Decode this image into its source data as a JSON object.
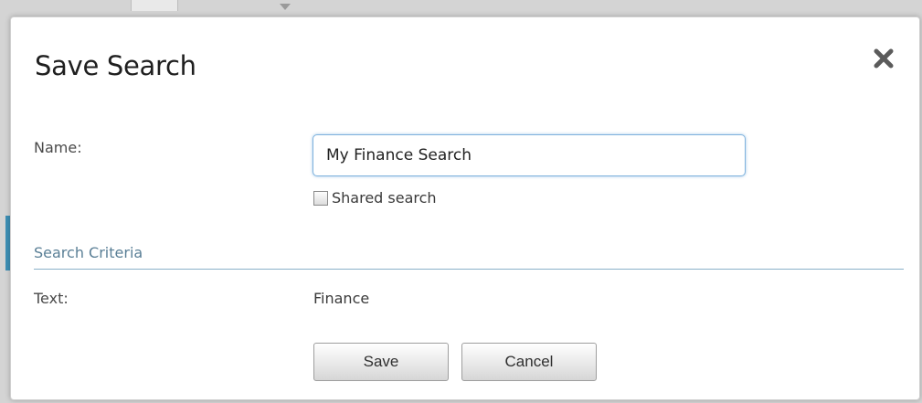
{
  "dialog": {
    "title": "Save Search",
    "close_icon": "close-icon"
  },
  "form": {
    "name_label": "Name:",
    "name_value": "My Finance Search",
    "shared_label": "Shared search",
    "shared_checked": false
  },
  "criteria": {
    "section_title": "Search Criteria",
    "text_label": "Text:",
    "text_value": "Finance"
  },
  "buttons": {
    "save_label": "Save",
    "cancel_label": "Cancel"
  },
  "colors": {
    "accent": "#3d8fb5",
    "input_focus_border": "#7fb2dd",
    "section_header": "#5a7f96",
    "divider": "#8ab0c8"
  }
}
